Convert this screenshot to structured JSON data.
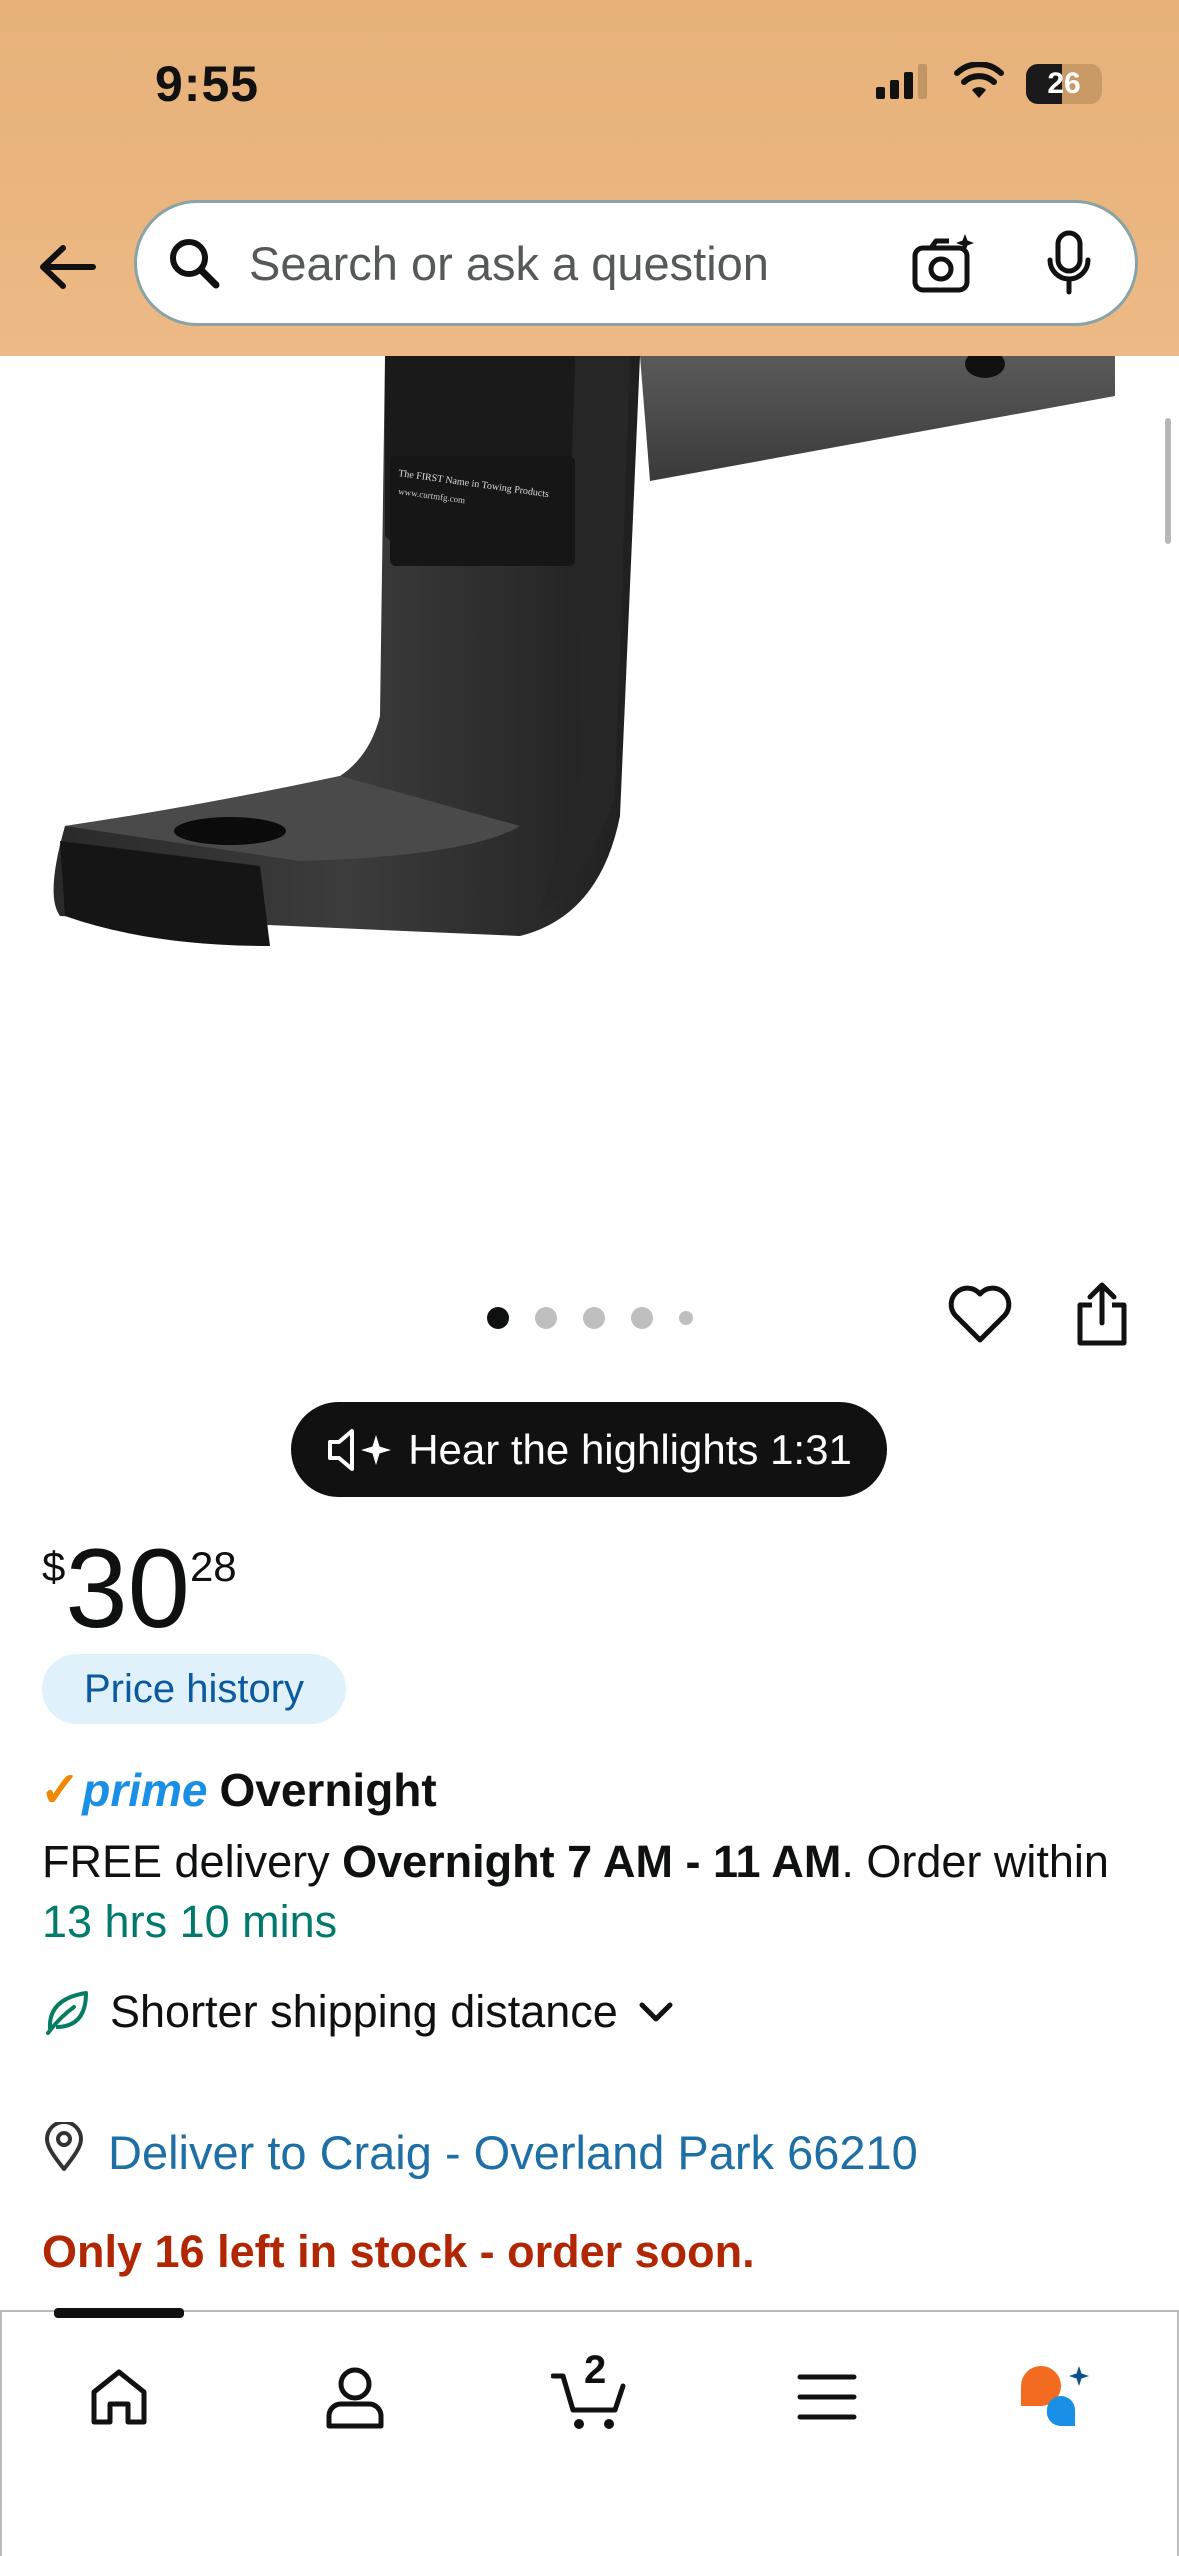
{
  "status_bar": {
    "time": "9:55",
    "battery": "26"
  },
  "search": {
    "placeholder": "Search or ask a question"
  },
  "carousel": {
    "total_images": 5,
    "active_index": 0
  },
  "highlights": {
    "label": "Hear the highlights 1:31"
  },
  "price": {
    "currency": "$",
    "whole": "30",
    "fraction": "28"
  },
  "price_history": {
    "label": "Price history"
  },
  "prime": {
    "check": "✓",
    "word": "prime",
    "label": "Overnight"
  },
  "delivery": {
    "prefix": "FREE delivery ",
    "window": "Overnight 7 AM - 11 AM",
    "middle": ". Order within ",
    "countdown": "13 hrs 10 mins"
  },
  "shipping_note": {
    "label": "Shorter shipping distance"
  },
  "deliver_to": {
    "label": "Deliver to Craig - Overland Park 66210"
  },
  "stock": {
    "label": "Only 16 left in stock - order soon."
  },
  "bottom_nav": {
    "cart_count": "2"
  },
  "colors": {
    "header_bg": "#e6b27a",
    "link": "#1d6fa5",
    "stock": "#b12704",
    "countdown": "#007a6c",
    "prime_blue": "#1a8fe6",
    "prime_check": "#f08804"
  }
}
